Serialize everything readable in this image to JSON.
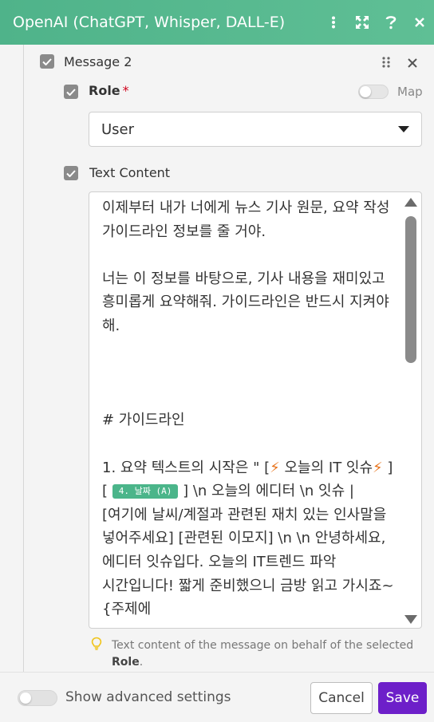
{
  "header": {
    "title": "OpenAI (ChatGPT, Whisper, DALL-E)",
    "icons": [
      "more-vertical-icon",
      "expand-icon",
      "help-icon",
      "close-icon"
    ]
  },
  "message": {
    "title": "Message 2",
    "role": {
      "label": "Role",
      "required_mark": "*",
      "map_label": "Map",
      "selected": "User"
    },
    "text_content": {
      "label": "Text Content",
      "lines": {
        "p1": "이제부터 내가 너에게 뉴스 기사 원문, 요약 작성 가이드라인 정보를 줄 거야.",
        "p2": "너는 이 정보를 바탕으로, 기사 내용을 재미있고 흥미롭게 요약해줘. 가이드라인은 반드시 지켜야 해.",
        "heading": "# 가이드라인",
        "item1_a": "1. 요약 텍스트의 시작은 \" [",
        "item1_b": " 오늘의 IT 잇슈",
        "item1_c": " ] [",
        "item1_pill": "4. 날짜 (A)",
        "item1_d": "] \\n 오늘의 에디터 \\n 잇슈 | [여기에 날씨/계절과 관련된 재치 있는 인사말을 넣어주세요] [관련된 이모지] \\n \\n 안녕하세요, 에디터 잇슈입다. 오늘의 IT트렌드 파악 시간입니다! 짧게 준비했으니 금방 읽고 가시죠~{주제에"
      },
      "hint_text": "Text content of the message on behalf of the selected",
      "hint_bold": "Role",
      "hint_end": "."
    }
  },
  "footer": {
    "advanced_label": "Show advanced settings",
    "cancel_label": "Cancel",
    "save_label": "Save"
  },
  "colors": {
    "header": "#55b88f",
    "save": "#6d1fc9",
    "pill": "#4bb58a",
    "bolt": "#e8741c"
  }
}
